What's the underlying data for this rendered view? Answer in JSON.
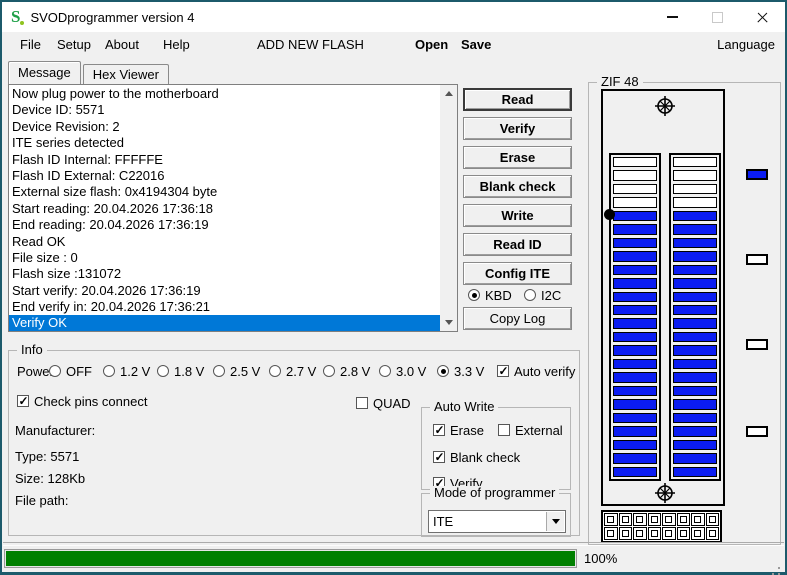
{
  "window": {
    "title": "SVODprogrammer version 4"
  },
  "menu": {
    "left": [
      "File",
      "Setup",
      "About",
      "Help"
    ],
    "add_new_flash": "ADD NEW FLASH",
    "open": "Open",
    "save": "Save",
    "language": "Language"
  },
  "tabs": [
    {
      "label": "Message",
      "active": true
    },
    {
      "label": "Hex Viewer",
      "active": false
    }
  ],
  "log": {
    "lines": [
      {
        "text": "Now plug power to the motherboard",
        "selected": false
      },
      {
        "text": "Device ID: 5571",
        "selected": false
      },
      {
        "text": "Device Revision: 2",
        "selected": false
      },
      {
        "text": "ITE series detected",
        "selected": false
      },
      {
        "text": "Flash ID Internal: FFFFFE",
        "selected": false
      },
      {
        "text": "Flash ID External: C22016",
        "selected": false
      },
      {
        "text": "External size flash: 0x4194304 byte",
        "selected": false
      },
      {
        "text": "Start reading: 20.04.2026 17:36:18",
        "selected": false
      },
      {
        "text": "End reading: 20.04.2026 17:36:19",
        "selected": false
      },
      {
        "text": "Read OK",
        "selected": false
      },
      {
        "text": "File size : 0",
        "selected": false
      },
      {
        "text": "Flash size :131072",
        "selected": false
      },
      {
        "text": "Start verify: 20.04.2026 17:36:19",
        "selected": false
      },
      {
        "text": "End verify in: 20.04.2026 17:36:21",
        "selected": false
      },
      {
        "text": "Verify OK",
        "selected": true
      }
    ]
  },
  "actions": {
    "buttons": [
      "Read",
      "Verify",
      "Erase",
      "Blank check",
      "Write",
      "Read ID",
      "Config ITE"
    ],
    "default_button": "Read",
    "interface_radios": [
      {
        "label": "KBD",
        "checked": true
      },
      {
        "label": "I2C",
        "checked": false
      }
    ],
    "copy_log": "Copy Log"
  },
  "zif": {
    "title": "ZIF 48",
    "pins_per_column": 24,
    "inactive_top_pins": 4,
    "pin1_column": 1,
    "pin1_slot": 5,
    "legend": [
      "active",
      "inactive",
      "inactive",
      "inactive"
    ],
    "connector": {
      "rows": 2,
      "cols": 8
    },
    "colors": {
      "active": "#0b1cf2",
      "inactive": "#ffffff"
    }
  },
  "info": {
    "title": "Info",
    "power_label": "Power:",
    "power_options": [
      {
        "label": "OFF",
        "checked": false
      },
      {
        "label": "1.2 V",
        "checked": false
      },
      {
        "label": "1.8 V",
        "checked": false
      },
      {
        "label": "2.5 V",
        "checked": false
      },
      {
        "label": "2.7 V",
        "checked": false
      },
      {
        "label": "2.8 V",
        "checked": false
      },
      {
        "label": "3.0 V",
        "checked": false
      },
      {
        "label": "3.3 V",
        "checked": true
      }
    ],
    "auto_verify": {
      "label": "Auto verify",
      "checked": true
    },
    "check_pins": {
      "label": "Check pins connect",
      "checked": true
    },
    "quad": {
      "label": "QUAD",
      "checked": false
    },
    "manufacturer": "Manufacturer:",
    "type": "Type: 5571",
    "size": "Size: 128Kb",
    "file_path": "File path:",
    "auto_write": {
      "title": "Auto Write",
      "checks": [
        {
          "label": "Erase",
          "checked": true
        },
        {
          "label": "External",
          "checked": false
        },
        {
          "label": "Blank check",
          "checked": true
        },
        {
          "label": "Verify",
          "checked": true
        }
      ]
    },
    "mode": {
      "title": "Mode of programmer",
      "value": "ITE"
    }
  },
  "statusbar": {
    "progress_percent": 100,
    "progress_label": "100%",
    "progress_color": "#008000"
  }
}
